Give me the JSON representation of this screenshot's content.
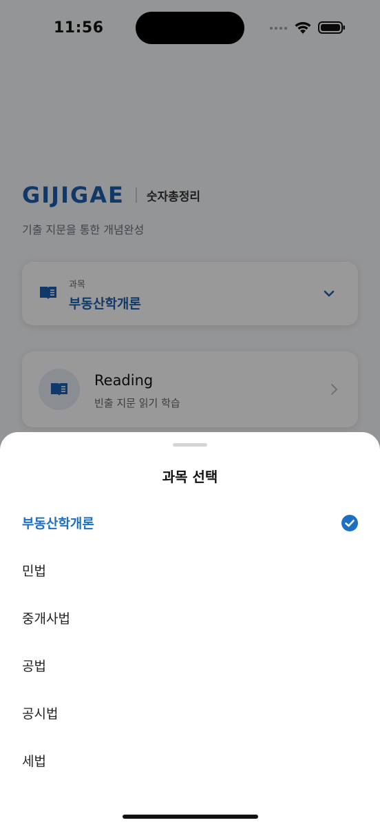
{
  "status_bar": {
    "time": "11:56"
  },
  "brand": {
    "logo": "GIJIGAE",
    "subtitle": "숫자총정리",
    "tagline": "기출 지문을 통한 개념완성"
  },
  "subject_card": {
    "label": "과목",
    "value": "부동산학개론"
  },
  "reading_card": {
    "title": "Reading",
    "subtitle": "빈출 지문 읽기 학습"
  },
  "sheet": {
    "title": "과목 선택",
    "options": [
      {
        "label": "부동산학개론",
        "selected": true
      },
      {
        "label": "민법",
        "selected": false
      },
      {
        "label": "중개사법",
        "selected": false
      },
      {
        "label": "공법",
        "selected": false
      },
      {
        "label": "공시법",
        "selected": false
      },
      {
        "label": "세법",
        "selected": false
      }
    ]
  },
  "colors": {
    "brand_blue": "#1b5fb0",
    "selected_blue": "#1b6fc4",
    "dim_overlay": "rgba(0,0,0,0.40)"
  },
  "icons": {
    "subject": "book-icon",
    "dropdown": "chevron-down-icon",
    "reading": "book-icon",
    "reading_arrow": "chevron-right-icon",
    "selected_check": "check-circle-icon"
  }
}
